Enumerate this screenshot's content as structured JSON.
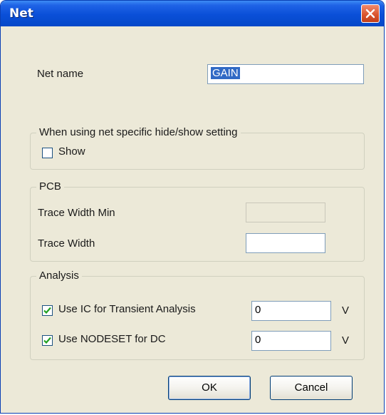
{
  "window": {
    "title": "Net"
  },
  "net_name": {
    "label": "Net name",
    "value": "GAIN"
  },
  "visibility": {
    "group_label": "When using net specific hide/show setting",
    "show_label": "Show",
    "show_checked": false
  },
  "pcb": {
    "group_label": "PCB",
    "trace_width_min_label": "Trace Width Min",
    "trace_width_min_value": "",
    "trace_width_label": "Trace Width",
    "trace_width_value": ""
  },
  "analysis": {
    "group_label": "Analysis",
    "ic_label": "Use IC for Transient Analysis",
    "ic_checked": true,
    "ic_value": "0",
    "ic_unit": "V",
    "nodeset_label": "Use NODESET for DC",
    "nodeset_checked": true,
    "nodeset_value": "0",
    "nodeset_unit": "V"
  },
  "buttons": {
    "ok": "OK",
    "cancel": "Cancel"
  }
}
